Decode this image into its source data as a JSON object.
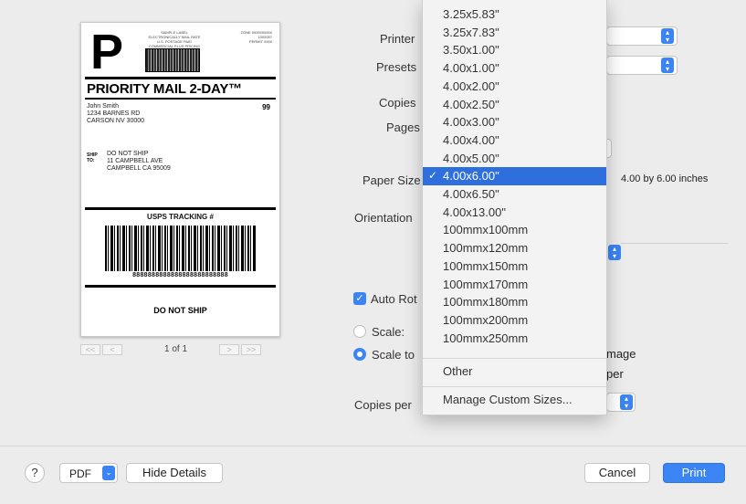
{
  "preview": {
    "big_letter": "P",
    "sample_header": "SAMPLE LABEL\nELECTRONICALLY MAIL RATE\nU.S. POSTAGE PAID\nCOMMERCIAL PLUS PRICING",
    "sample_right": "ZONE 0000000000\n1000057\nPERMIT 0000",
    "service_title": "PRIORITY MAIL 2-DAY™",
    "from_address": "John Smith\n1234 BARNES RD\nCARSON NV 30000",
    "from_code": "99",
    "ship_to_tag": "SHIP\nTO:",
    "ship_to_address": "DO NOT SHIP\n11 CAMPBELL AVE\nCAMPBELL CA 95009",
    "tracking_title": "USPS TRACKING #",
    "tracking_number": "8888888888888888888888888",
    "footer_text": "DO NOT SHIP",
    "pager": {
      "first": "<<",
      "prev": "<",
      "text": "1 of 1",
      "next": ">",
      "last": ">>"
    }
  },
  "settings": {
    "printer_label": "Printer",
    "presets_label": "Presets",
    "copies_label": "Copies",
    "pages_label": "Pages",
    "paper_size_label": "Paper Size",
    "paper_size_desc": "4.00 by 6.00 inches",
    "orientation_label": "Orientation",
    "auto_rotate_label": "Auto Rot",
    "scale_label": "Scale:",
    "scale_to_fit_label": "Scale to",
    "image_partial": "mage",
    "paper_partial": "per",
    "copies_per_label": "Copies per"
  },
  "paper_menu": {
    "items": [
      {
        "label": "3.25x5.83\"",
        "selected": false
      },
      {
        "label": "3.25x7.83\"",
        "selected": false
      },
      {
        "label": "3.50x1.00\"",
        "selected": false
      },
      {
        "label": "4.00x1.00\"",
        "selected": false
      },
      {
        "label": "4.00x2.00\"",
        "selected": false
      },
      {
        "label": "4.00x2.50\"",
        "selected": false
      },
      {
        "label": "4.00x3.00\"",
        "selected": false
      },
      {
        "label": "4.00x4.00\"",
        "selected": false
      },
      {
        "label": "4.00x5.00\"",
        "selected": false
      },
      {
        "label": "4.00x6.00\"",
        "selected": true
      },
      {
        "label": "4.00x6.50\"",
        "selected": false
      },
      {
        "label": "4.00x13.00\"",
        "selected": false
      },
      {
        "label": "100mmx100mm",
        "selected": false
      },
      {
        "label": "100mmx120mm",
        "selected": false
      },
      {
        "label": "100mmx150mm",
        "selected": false
      },
      {
        "label": "100mmx170mm",
        "selected": false
      },
      {
        "label": "100mmx180mm",
        "selected": false
      },
      {
        "label": "100mmx200mm",
        "selected": false
      },
      {
        "label": "100mmx250mm",
        "selected": false
      }
    ],
    "check_mark": "✓",
    "other": "Other",
    "manage_custom": "Manage Custom Sizes..."
  },
  "footer": {
    "help": "?",
    "pdf": "PDF",
    "hide_details": "Hide Details",
    "cancel": "Cancel",
    "print": "Print"
  },
  "icons": {
    "stepper": "up-down-arrows-icon",
    "checkbox_mark": "✓",
    "dropdown_arrow": "⌄"
  },
  "colors": {
    "accent": "#3a84f3",
    "menu_selection": "#2f6fdd",
    "dialog_bg": "#ececec"
  }
}
